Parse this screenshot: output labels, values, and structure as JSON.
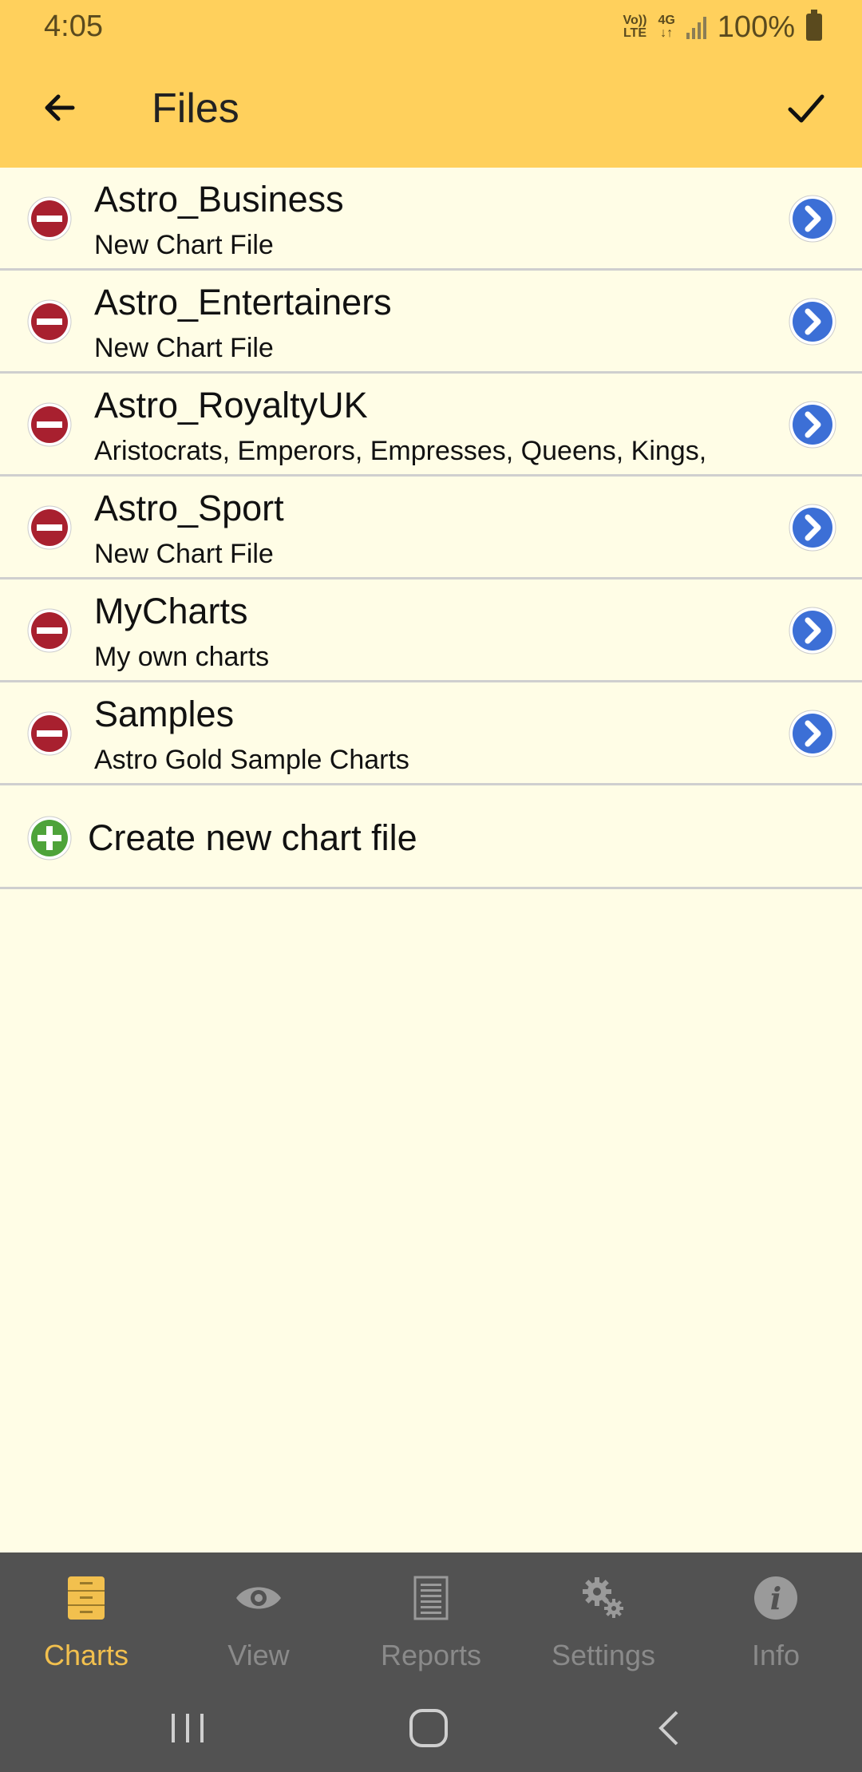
{
  "status_bar": {
    "time": "4:05",
    "volte": "Vo))\nLTE",
    "network": "4G",
    "battery": "100%"
  },
  "app_bar": {
    "title": "Files",
    "back_icon": "arrow-left-icon",
    "confirm_icon": "checkmark-icon"
  },
  "files": [
    {
      "name": "Astro_Business",
      "description": "New Chart File"
    },
    {
      "name": "Astro_Entertainers",
      "description": "New Chart File"
    },
    {
      "name": "Astro_RoyaltyUK",
      "description": "Aristocrats, Emperors, Empresses, Queens, Kings,"
    },
    {
      "name": "Astro_Sport",
      "description": "New Chart File"
    },
    {
      "name": "MyCharts",
      "description": "My own charts"
    },
    {
      "name": "Samples",
      "description": "Astro Gold Sample Charts"
    }
  ],
  "create": {
    "label": "Create new chart file"
  },
  "bottom_nav": [
    {
      "label": "Charts",
      "icon": "file-cabinet-icon",
      "active": true
    },
    {
      "label": "View",
      "icon": "eye-icon",
      "active": false
    },
    {
      "label": "Reports",
      "icon": "document-icon",
      "active": false
    },
    {
      "label": "Settings",
      "icon": "gears-icon",
      "active": false
    },
    {
      "label": "Info",
      "icon": "info-icon",
      "active": false
    }
  ],
  "colors": {
    "app_bar": "#ffd05c",
    "background": "#fffde6",
    "delete": "#a8202f",
    "navigate": "#3c6fd6",
    "add": "#4ea33a",
    "nav_bg": "#525252",
    "nav_active": "#f2c04e"
  }
}
